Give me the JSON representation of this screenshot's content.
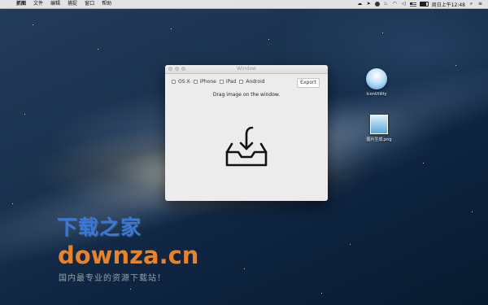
{
  "menubar": {
    "apple_glyph": "",
    "items": [
      "抓图",
      "文件",
      "编辑",
      "捕捉",
      "窗口",
      "帮助"
    ],
    "clock": "周日上午12:48"
  },
  "window": {
    "title": "Window",
    "checkboxes": [
      "OS X",
      "iPhone",
      "iPad",
      "Android"
    ],
    "export_label": "Export",
    "hint": "Drag image on the window."
  },
  "desktop_icons": [
    {
      "label": "IconUtility"
    },
    {
      "label": "图片生成.png"
    }
  ],
  "watermark": {
    "cn": "下载之家",
    "en": "downza.cn",
    "tagline": "国内最专业的资源下载站！"
  }
}
